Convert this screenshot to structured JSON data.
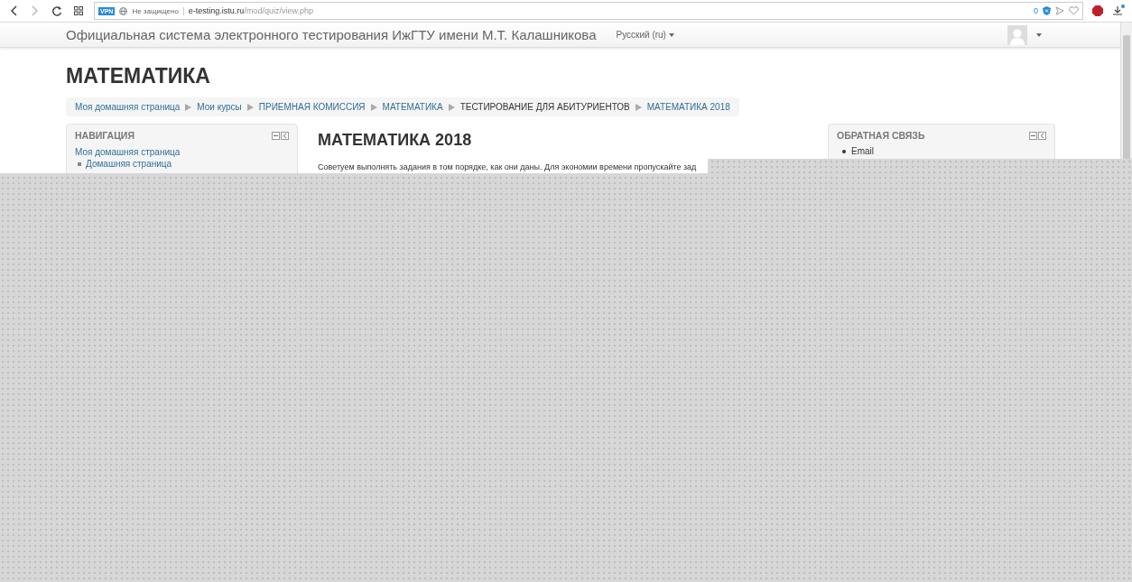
{
  "browser": {
    "vpn": "VPN",
    "security": "Не защищено",
    "url_host": "e-testing.istu.ru",
    "url_path": "/mod/quiz/view.php",
    "counter": "0"
  },
  "navbar": {
    "site_title": "Официальная система электронного тестирования ИжГТУ имени М.Т. Калашникова",
    "language": "Русский (ru)"
  },
  "page_title": "МАТЕМАТИКА",
  "breadcrumb": [
    {
      "label": "Моя домашняя страница",
      "link": true
    },
    {
      "label": "Мои курсы",
      "link": true
    },
    {
      "label": "ПРИЕМНАЯ КОМИССИЯ",
      "link": true
    },
    {
      "label": "МАТЕМАТИКА",
      "link": true
    },
    {
      "label": "ТЕСТИРОВАНИЕ ДЛЯ АБИТУРИЕНТОВ",
      "link": false
    },
    {
      "label": "МАТЕМАТИКА 2018",
      "link": true
    }
  ],
  "navigation": {
    "title": "НАВИГАЦИЯ",
    "items": [
      {
        "label": "Моя домашняя страница",
        "children": [
          {
            "label": "Домашняя страница"
          }
        ]
      }
    ]
  },
  "quiz": {
    "title": "МАТЕМАТИКА 2018",
    "intro": "Советуем выполнять задания в том порядке, как они даны. Для экономии времени пропускайте зад"
  },
  "feedback": {
    "title": "ОБРАТНАЯ СВЯЗЬ",
    "items": [
      "Email"
    ]
  }
}
